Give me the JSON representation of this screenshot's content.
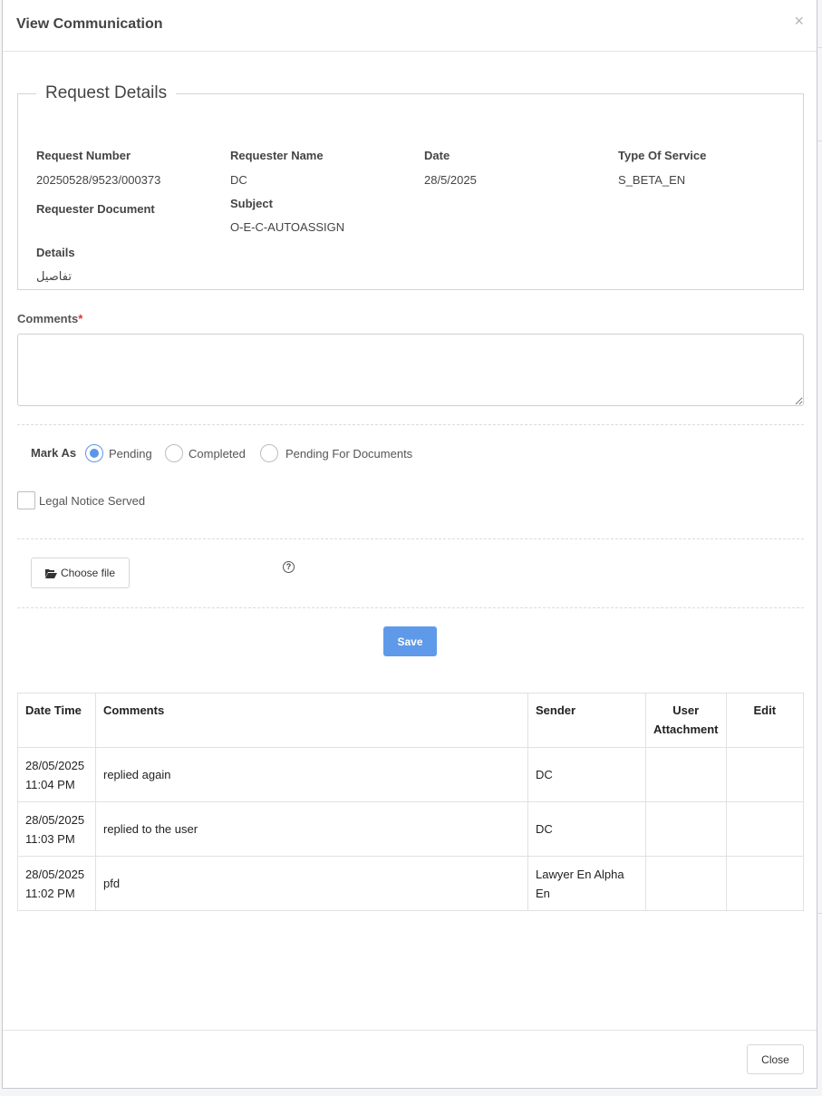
{
  "modal": {
    "title": "View Communication",
    "close_icon": "×"
  },
  "request": {
    "legend": "Request Details",
    "fields": {
      "request_number_label": "Request Number",
      "request_number": "20250528/9523/000373",
      "requester_name_label": "Requester Name",
      "requester_name": "DC",
      "date_label": "Date",
      "date": "28/5/2025",
      "type_label": "Type Of Service",
      "type": "S_BETA_EN",
      "requester_document_label": "Requester Document",
      "subject_label": "Subject",
      "subject": "O-E-C-AUTOASSIGN",
      "details_label": "Details",
      "details": "تفاصيل"
    }
  },
  "form": {
    "comments_label": "Comments",
    "required_mark": "*",
    "comments_value": "",
    "mark_as_label": "Mark As",
    "options": [
      "Pending",
      "Completed",
      "Pending For Documents"
    ],
    "selected": "Pending",
    "legal_notice_label": "Legal Notice Served",
    "legal_notice_checked": false,
    "choose_file_label": "Choose file",
    "help_icon": "?",
    "save_label": "Save"
  },
  "table": {
    "headers": [
      "Date Time",
      "Comments",
      "Sender",
      "User Attachment",
      "Edit"
    ],
    "rows": [
      {
        "date": "28/05/2025",
        "time": "11:04 PM",
        "comment": "replied again",
        "sender": "DC"
      },
      {
        "date": "28/05/2025",
        "time": "11:03 PM",
        "comment": "replied to the user",
        "sender": "DC"
      },
      {
        "date": "28/05/2025",
        "time": "11:02 PM",
        "comment": "pfd",
        "sender": "Lawyer En Alpha En"
      }
    ]
  },
  "footer": {
    "close_label": "Close"
  },
  "colors": {
    "accent": "#5e9ae9",
    "required": "#e03030"
  }
}
